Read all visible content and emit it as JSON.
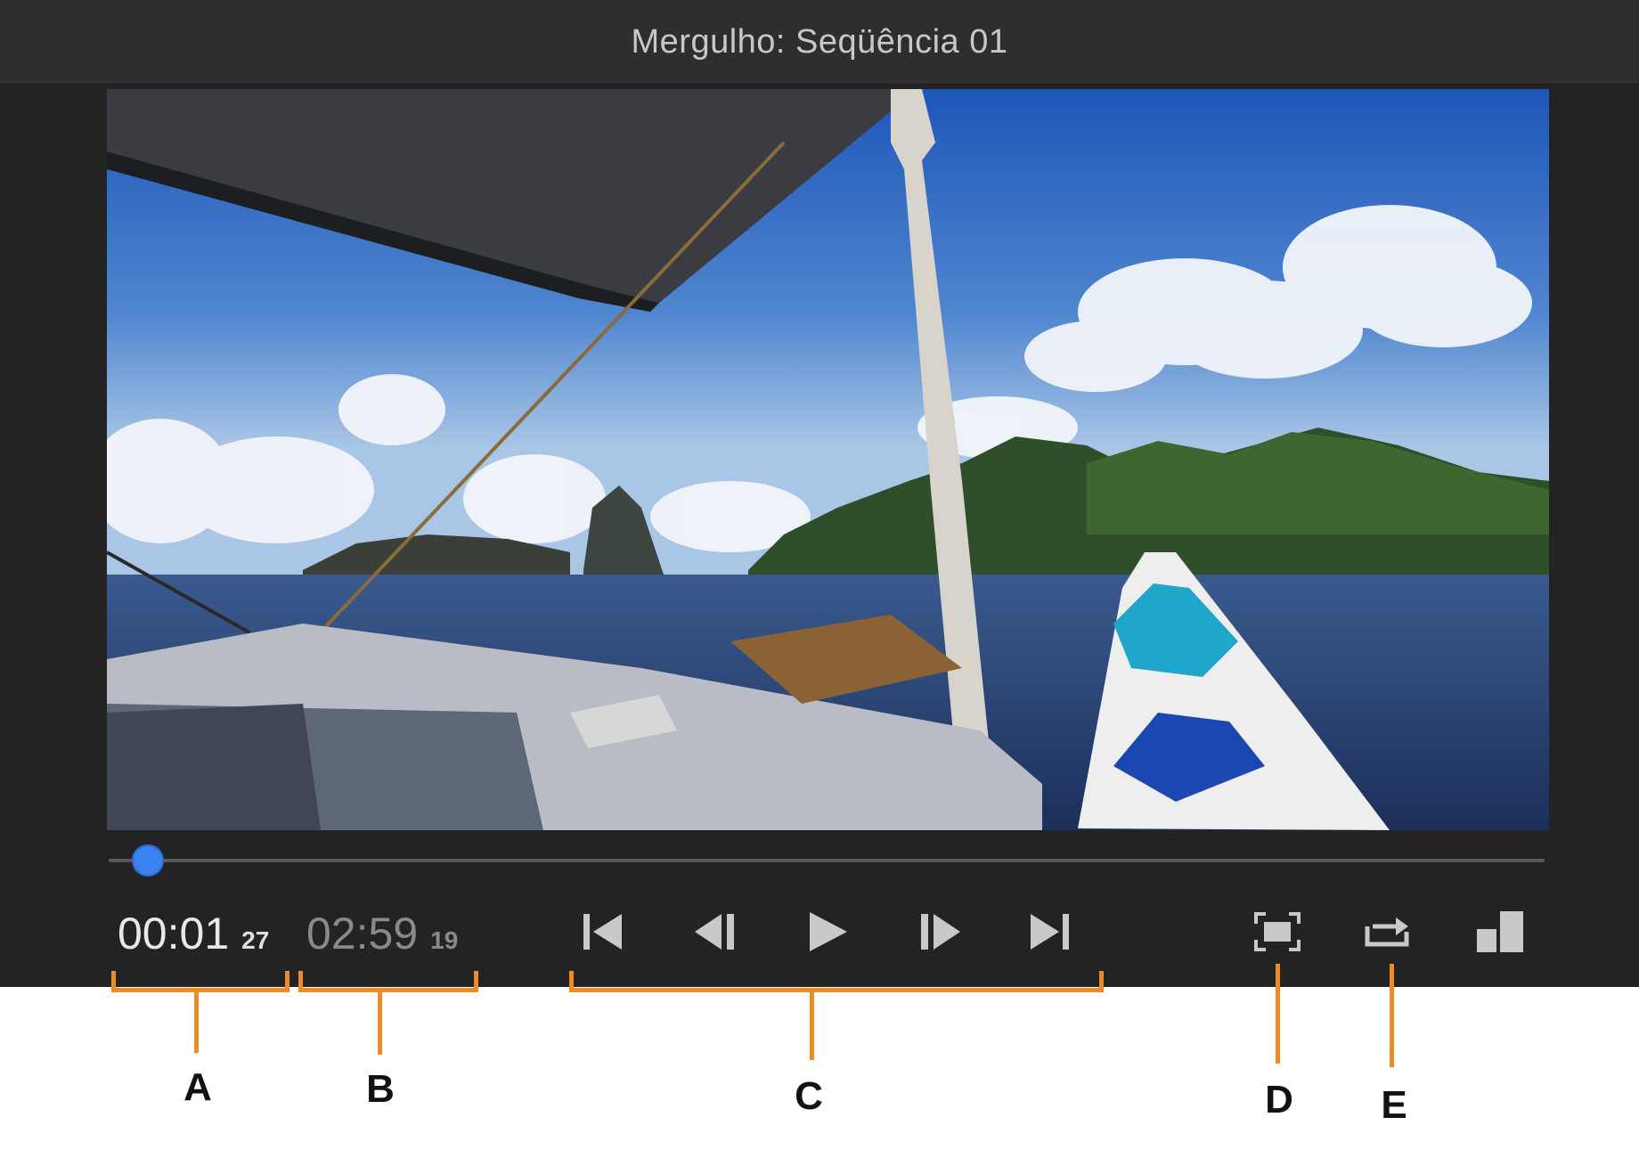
{
  "window": {
    "title": "Mergulho: Seqüência 01"
  },
  "playback": {
    "current_time": "00:01",
    "current_frames": "27",
    "duration": "02:59",
    "duration_frames": "19",
    "progress_fraction": 0.021
  },
  "controls": [
    {
      "name": "go-to-start-button",
      "icon": "skip-to-start-icon"
    },
    {
      "name": "step-back-button",
      "icon": "step-back-frame-icon"
    },
    {
      "name": "play-button",
      "icon": "play-icon"
    },
    {
      "name": "step-forward-button",
      "icon": "step-forward-frame-icon"
    },
    {
      "name": "go-to-end-button",
      "icon": "skip-to-end-icon"
    },
    {
      "name": "fit-frame-button",
      "icon": "fit-frame-icon"
    },
    {
      "name": "loop-button",
      "icon": "loop-icon"
    },
    {
      "name": "panel-size-button",
      "icon": "panel-size-icon"
    }
  ],
  "callouts": {
    "a": "A",
    "b": "B",
    "c": "C",
    "d": "D",
    "e": "E"
  },
  "colors": {
    "accent": "#3b82f0",
    "callout": "#f08a24",
    "panel_bg": "#232323",
    "icon": "#c9c9c9"
  }
}
